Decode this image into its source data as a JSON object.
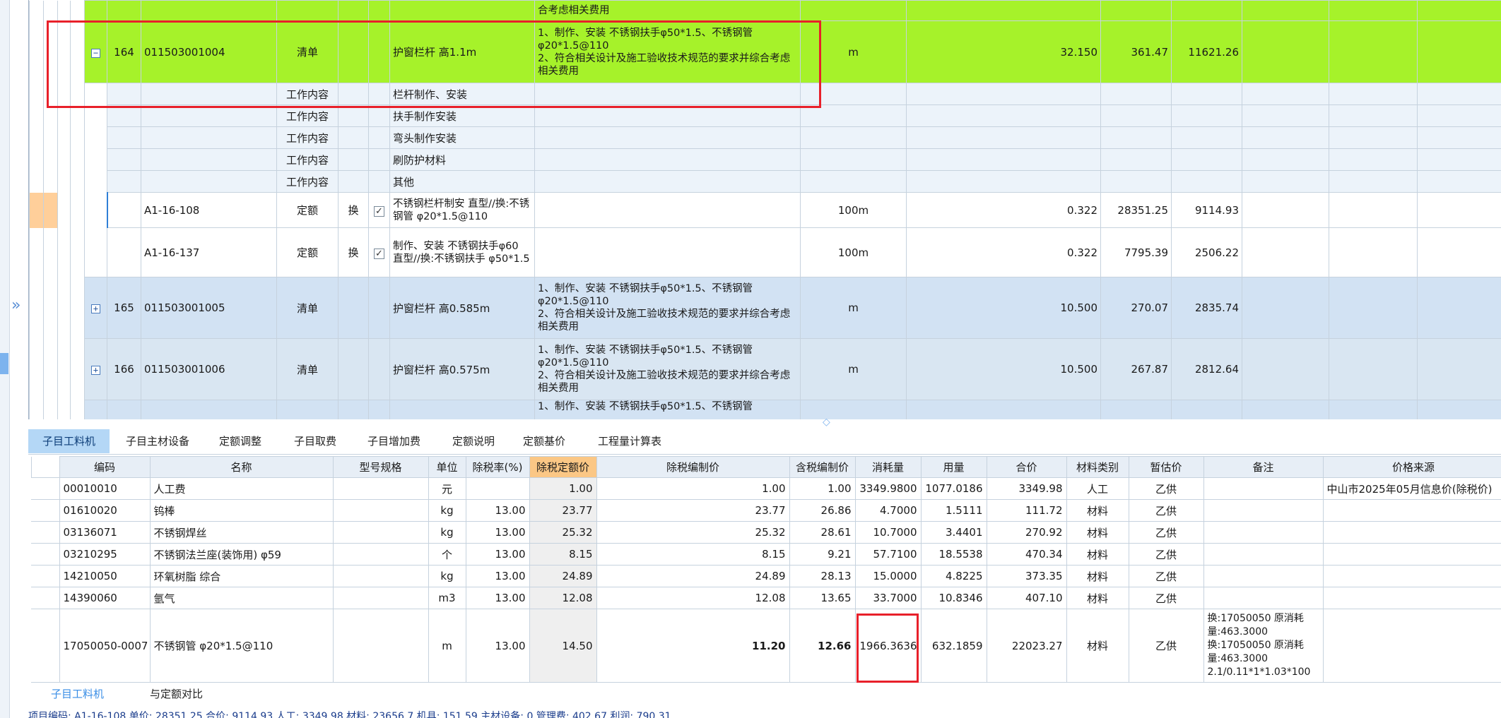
{
  "upper_grid": {
    "rows": [
      {
        "id": "row-163-tail",
        "style": "green",
        "desc": "合考虑相关费用"
      },
      {
        "id": "row-164",
        "style": "green",
        "expander": "−",
        "seq": "164",
        "code": "011503001004",
        "type": "清单",
        "name": "护窗栏杆 高1.1m",
        "desc": "1、制作、安装 不锈钢扶手φ50*1.5、不锈钢管φ20*1.5@110\n2、符合相关设计及施工验收技术规范的要求并综合考虑相关费用",
        "unit": "m",
        "qty": "32.150",
        "price": "361.47",
        "total": "11621.26"
      },
      {
        "id": "row-wc-1",
        "style": "pale",
        "type": "工作内容",
        "name": "栏杆制作、安装"
      },
      {
        "id": "row-wc-2",
        "style": "pale",
        "type": "工作内容",
        "name": "扶手制作安装"
      },
      {
        "id": "row-wc-3",
        "style": "pale",
        "type": "工作内容",
        "name": "弯头制作安装"
      },
      {
        "id": "row-wc-4",
        "style": "pale",
        "type": "工作内容",
        "name": "刷防护材料"
      },
      {
        "id": "row-wc-5",
        "style": "pale",
        "type": "工作内容",
        "name": "其他"
      },
      {
        "id": "row-quota-1",
        "style": "white",
        "selected": true,
        "code": "A1-16-108",
        "type": "定额",
        "swap": "换",
        "check": "✓",
        "name": "不锈钢栏杆制安 直型//换:不锈钢管 φ20*1.5@110",
        "unit": "100m",
        "qty": "0.322",
        "price": "28351.25",
        "total": "9114.93"
      },
      {
        "id": "row-quota-2",
        "style": "white",
        "code": "A1-16-137",
        "type": "定额",
        "swap": "换",
        "check": "✓",
        "name": "制作、安装 不锈钢扶手φ60 直型//换:不锈钢扶手 φ50*1.5",
        "unit": "100m",
        "qty": "0.322",
        "price": "7795.39",
        "total": "2506.22"
      },
      {
        "id": "row-165",
        "style": "blue",
        "expander": "+",
        "seq": "165",
        "code": "011503001005",
        "type": "清单",
        "name": "护窗栏杆 高0.585m",
        "desc": "1、制作、安装 不锈钢扶手φ50*1.5、不锈钢管φ20*1.5@110\n2、符合相关设计及施工验收技术规范的要求并综合考虑相关费用",
        "unit": "m",
        "qty": "10.500",
        "price": "270.07",
        "total": "2835.74"
      },
      {
        "id": "row-166",
        "style": "blue",
        "expander": "+",
        "seq": "166",
        "code": "011503001006",
        "type": "清单",
        "name": "护窗栏杆 高0.575m",
        "desc": "1、制作、安装 不锈钢扶手φ50*1.5、不锈钢管φ20*1.5@110\n2、符合相关设计及施工验收技术规范的要求并综合考虑相关费用",
        "unit": "m",
        "qty": "10.500",
        "price": "267.87",
        "total": "2812.64"
      },
      {
        "id": "row-167-head",
        "style": "blue",
        "desc": "1、制作、安装 不锈钢扶手φ50*1.5、不锈钢管"
      }
    ]
  },
  "tabs": [
    {
      "label": "子目工料机",
      "active": true
    },
    {
      "label": "子目主材设备"
    },
    {
      "label": "定额调整"
    },
    {
      "label": "子目取费"
    },
    {
      "label": "子目增加费"
    },
    {
      "label": "定额说明"
    },
    {
      "label": "定额基价"
    },
    {
      "label": "工程量计算表"
    }
  ],
  "lower_grid": {
    "headers": [
      "编码",
      "名称",
      "型号规格",
      "单位",
      "除税率(%)",
      "除税定额价",
      "除税编制价",
      "含税编制价",
      "消耗量",
      "用量",
      "合价",
      "材料类别",
      "暂估价",
      "备注",
      "价格来源"
    ],
    "rows": [
      {
        "code": "00010010",
        "name": "人工费",
        "spec": "",
        "unit": "元",
        "tax_rate": "",
        "quota_price": "1.00",
        "budget_price": "1.00",
        "tax_price": "1.00",
        "consumption": "3349.9800",
        "usage": "1077.0186",
        "total": "3349.98",
        "category": "人工",
        "estimate": "乙供",
        "note": "",
        "source": "中山市2025年05月信息价(除税价)"
      },
      {
        "code": "01610020",
        "name": "钨棒",
        "spec": "",
        "unit": "kg",
        "tax_rate": "13.00",
        "quota_price": "23.77",
        "budget_price": "23.77",
        "tax_price": "26.86",
        "consumption": "4.7000",
        "usage": "1.5111",
        "total": "111.72",
        "category": "材料",
        "estimate": "乙供",
        "note": "",
        "source": ""
      },
      {
        "code": "03136071",
        "name": "不锈钢焊丝",
        "spec": "",
        "unit": "kg",
        "tax_rate": "13.00",
        "quota_price": "25.32",
        "budget_price": "25.32",
        "tax_price": "28.61",
        "consumption": "10.7000",
        "usage": "3.4401",
        "total": "270.92",
        "category": "材料",
        "estimate": "乙供",
        "note": "",
        "source": ""
      },
      {
        "code": "03210295",
        "name": "不锈钢法兰座(装饰用) φ59",
        "spec": "",
        "unit": "个",
        "tax_rate": "13.00",
        "quota_price": "8.15",
        "budget_price": "8.15",
        "tax_price": "9.21",
        "consumption": "57.7100",
        "usage": "18.5538",
        "total": "470.34",
        "category": "材料",
        "estimate": "乙供",
        "note": "",
        "source": ""
      },
      {
        "code": "14210050",
        "name": "环氧树脂 综合",
        "spec": "",
        "unit": "kg",
        "tax_rate": "13.00",
        "quota_price": "24.89",
        "budget_price": "24.89",
        "tax_price": "28.13",
        "consumption": "15.0000",
        "usage": "4.8225",
        "total": "373.35",
        "category": "材料",
        "estimate": "乙供",
        "note": "",
        "source": ""
      },
      {
        "code": "14390060",
        "name": "氩气",
        "spec": "",
        "unit": "m3",
        "tax_rate": "13.00",
        "quota_price": "12.08",
        "budget_price": "12.08",
        "tax_price": "13.65",
        "consumption": "33.7000",
        "usage": "10.8346",
        "total": "407.10",
        "category": "材料",
        "estimate": "乙供",
        "note": "",
        "source": ""
      },
      {
        "code": "17050050-0007",
        "name": "不锈钢管 φ20*1.5@110",
        "spec": "",
        "unit": "m",
        "tax_rate": "13.00",
        "quota_price": "14.50",
        "budget_price": "11.20",
        "tax_price": "12.66",
        "consumption": "1966.3636",
        "usage": "632.1859",
        "total": "22023.27",
        "category": "材料",
        "estimate": "乙供",
        "note": "换:17050050 原消耗量:463.3000 换:17050050 原消耗量:463.3000 2.1/0.11*1*1.03*100",
        "source": ""
      }
    ]
  },
  "bottom_tabs": [
    {
      "label": "子目工料机",
      "active": true
    },
    {
      "label": "与定额对比"
    }
  ],
  "status_bar": "项目编码: A1-16-108 单价: 28351.25 合价: 9114.93 人工: 3349.98 材料: 23656.7 机具: 151.59 主材设备: 0 管理费: 402.67 利润: 790.31",
  "colors": {
    "list_row": "#a6f22a",
    "work_content_row": "#ecf3fa",
    "collapsed_row": "#d2e2f3",
    "active_tab": "#b4d7f6",
    "highlight_header": "#fbc785",
    "annotation_box": "#e8202a"
  }
}
